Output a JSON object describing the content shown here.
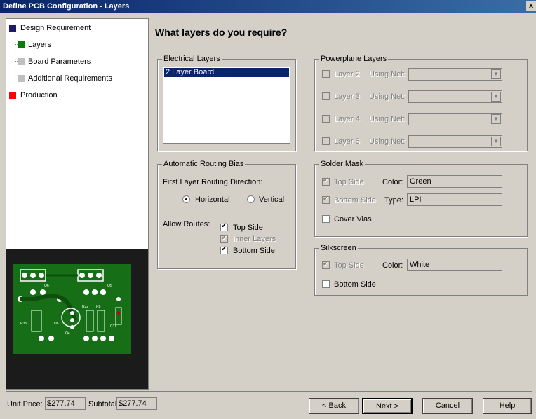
{
  "window": {
    "title": "Define PCB Configuration - Layers",
    "close_label": "x"
  },
  "sidebar": {
    "items": [
      {
        "label": "Design Requirement",
        "color": "#1c1c6b"
      },
      {
        "label": "Layers",
        "color": "#0a7a0a"
      },
      {
        "label": "Board Parameters",
        "color": "#c0c0c0"
      },
      {
        "label": "Additional Requirements",
        "color": "#c0c0c0"
      },
      {
        "label": "Production",
        "color": "#ff0000"
      }
    ]
  },
  "main": {
    "heading": "What layers do you require?"
  },
  "electrical": {
    "legend": "Electrical Layers",
    "items": [
      "2 Layer Board"
    ]
  },
  "powerplane": {
    "legend": "Powerplane Layers",
    "using_net_label": "Using Net:",
    "layers": [
      "Layer 2",
      "Layer 3",
      "Layer 4",
      "Layer 5"
    ]
  },
  "routing": {
    "legend": "Automatic Routing Bias",
    "direction_label": "First Layer Routing Direction:",
    "horizontal": "Horizontal",
    "vertical": "Vertical",
    "allow_label": "Allow Routes:",
    "top": "Top Side",
    "inner": "Inner Layers",
    "bottom": "Bottom Side"
  },
  "soldermask": {
    "legend": "Solder Mask",
    "top": "Top Side",
    "bottom": "Bottom Side",
    "color_label": "Color:",
    "color_value": "Green",
    "type_label": "Type:",
    "type_value": "LPI",
    "cover_vias": "Cover Vias"
  },
  "silkscreen": {
    "legend": "Silkscreen",
    "top": "Top Side",
    "color_label": "Color:",
    "color_value": "White",
    "bottom": "Bottom Side"
  },
  "footer": {
    "unit_price_label": "Unit Price:",
    "unit_price": "$277.74",
    "subtotal_label": "Subtotal:",
    "subtotal": "$277.74",
    "back": "< Back",
    "next": "Next >",
    "cancel": "Cancel",
    "help": "Help"
  },
  "pcb_labels": {
    "q6": "Q6",
    "q5": "Q5",
    "r35": "R35",
    "d6": "D6",
    "q4": "Q4",
    "r22": "R22",
    "r8": "R8",
    "c11": "C11"
  }
}
